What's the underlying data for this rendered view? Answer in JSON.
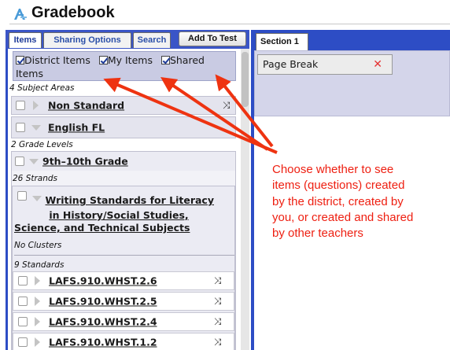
{
  "window": {
    "title": "Gradebook",
    "icon": "gradebook-icon"
  },
  "left_panel": {
    "tabs": [
      {
        "label": "Items",
        "active": true
      },
      {
        "label": "Sharing Options",
        "active": false
      },
      {
        "label": "Search",
        "active": false
      }
    ],
    "add_to_test_label": "Add To Test",
    "filters": {
      "district": {
        "label": "District Items",
        "checked": true
      },
      "my": {
        "label": "My Items",
        "checked": true
      },
      "shared_line1": "Shared",
      "shared_line2": "Items",
      "shared_checked": true
    },
    "tree": {
      "subject_areas_count": "4 Subject Areas",
      "non_standard": "Non Standard",
      "english_fl": "English FL",
      "grade_levels_count": "2 Grade Levels",
      "grade": "9th–10th Grade",
      "strands_count": "26 Strands",
      "writing_standards": {
        "line1": "Writing Standards for Literacy",
        "line2": "in History/Social Studies,",
        "line3": "Science, and Technical Subjects"
      },
      "clusters": "No Clusters",
      "standards_count": "9 Standards",
      "standards": [
        "LAFS.910.WHST.2.6",
        "LAFS.910.WHST.2.5",
        "LAFS.910.WHST.2.4",
        "LAFS.910.WHST.1.2"
      ]
    }
  },
  "right_panel": {
    "section_tab": "Section 1",
    "page_break_label": "Page Break"
  },
  "annotation": {
    "lines": [
      "Choose whether to see",
      "items (questions) created",
      "by the district, created by",
      "you, or created and shared",
      "by other teachers"
    ],
    "color": "#ee1f11"
  },
  "colors": {
    "panel_blue": "#2d4dc5",
    "filter_bar": "#c9cbe3",
    "row_bg": "#e4e4ee",
    "delete_red": "#e53232"
  }
}
